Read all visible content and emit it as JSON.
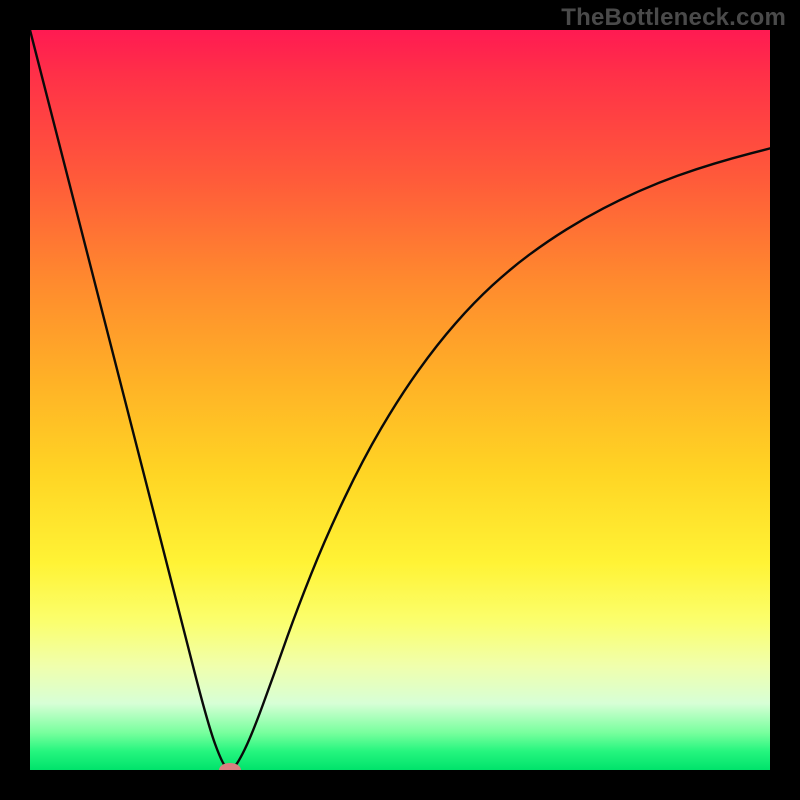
{
  "watermark": "TheBottleneck.com",
  "chart_data": {
    "type": "line",
    "title": "",
    "xlabel": "",
    "ylabel": "",
    "xlim": [
      0,
      100
    ],
    "ylim": [
      0,
      100
    ],
    "axes_visible": false,
    "grid": false,
    "background_gradient": {
      "direction": "vertical",
      "stops": [
        {
          "pos": 0.0,
          "color": "#ff1a52"
        },
        {
          "pos": 0.2,
          "color": "#ff5a3a"
        },
        {
          "pos": 0.48,
          "color": "#ffb326"
        },
        {
          "pos": 0.72,
          "color": "#fff335"
        },
        {
          "pos": 0.9,
          "color": "#d7ffd6"
        },
        {
          "pos": 1.0,
          "color": "#00e36b"
        }
      ]
    },
    "series": [
      {
        "name": "bottleneck-curve",
        "x": [
          0,
          5,
          10,
          15,
          20,
          24,
          26,
          27,
          28,
          30,
          33,
          36,
          40,
          45,
          50,
          55,
          60,
          65,
          70,
          75,
          80,
          85,
          90,
          95,
          100
        ],
        "y": [
          100,
          80.5,
          61,
          41.5,
          22,
          6.3,
          0.8,
          0,
          0.7,
          4.8,
          13,
          21.5,
          31.5,
          42,
          50.5,
          57.5,
          63.2,
          67.8,
          71.5,
          74.6,
          77.2,
          79.4,
          81.2,
          82.7,
          84
        ]
      }
    ],
    "marker": {
      "x": 27,
      "y": 0,
      "color": "#d97f80",
      "shape": "ellipse"
    },
    "frame": {
      "color": "#000000",
      "thickness_px": 30
    }
  },
  "colors": {
    "frame": "#000000",
    "curve": "#0a0a0a",
    "marker": "#d97f80",
    "watermark": "#4a4a4a"
  }
}
